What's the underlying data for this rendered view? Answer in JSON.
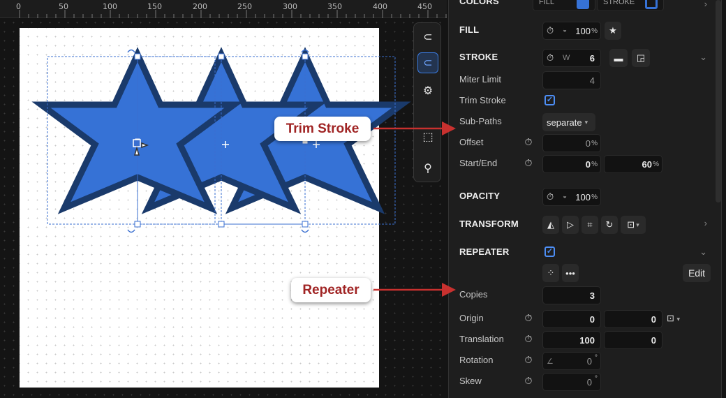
{
  "ruler": {
    "labels": [
      "0",
      "50",
      "100",
      "150",
      "200",
      "250",
      "300",
      "350",
      "400",
      "450"
    ]
  },
  "colors": {
    "accent": "#4d8ef5",
    "star_fill": "#3672d6",
    "star_stroke": "#1a3a6b",
    "callout_text": "#a02424",
    "arrow": "#c8312f"
  },
  "toolbar": {
    "icons": [
      "magnet-icon",
      "snap-icon",
      "gear-icon",
      "crop-icon",
      "zoom-icon"
    ]
  },
  "panel": {
    "colors": {
      "label": "COLORS",
      "fill_label": "FILL",
      "stroke_label": "STROKE"
    },
    "fill": {
      "label": "FILL",
      "opacity": "100",
      "unit": "%"
    },
    "stroke": {
      "label": "STROKE",
      "width_letter": "W",
      "width": "6"
    },
    "miter_limit": {
      "label": "Miter Limit",
      "value": "4"
    },
    "trim_stroke": {
      "label": "Trim Stroke",
      "checked": true
    },
    "sub_paths": {
      "label": "Sub-Paths",
      "value": "separate"
    },
    "offset": {
      "label": "Offset",
      "value": "0",
      "unit": "%"
    },
    "start_end": {
      "label": "Start/End",
      "start": "0",
      "end": "60",
      "unit": "%"
    },
    "opacity": {
      "label": "OPACITY",
      "value": "100",
      "unit": "%"
    },
    "transform": {
      "label": "TRANSFORM"
    },
    "repeater": {
      "label": "REPEATER",
      "checked": true,
      "edit_label": "Edit"
    },
    "copies": {
      "label": "Copies",
      "value": "3"
    },
    "origin": {
      "label": "Origin",
      "x": "0",
      "y": "0"
    },
    "translation": {
      "label": "Translation",
      "x": "100",
      "y": "0"
    },
    "rotation": {
      "label": "Rotation",
      "value": "0",
      "unit": "°"
    },
    "skew": {
      "label": "Skew",
      "value": "0",
      "unit": "°"
    }
  },
  "callouts": {
    "trim_stroke": "Trim Stroke",
    "repeater": "Repeater"
  }
}
